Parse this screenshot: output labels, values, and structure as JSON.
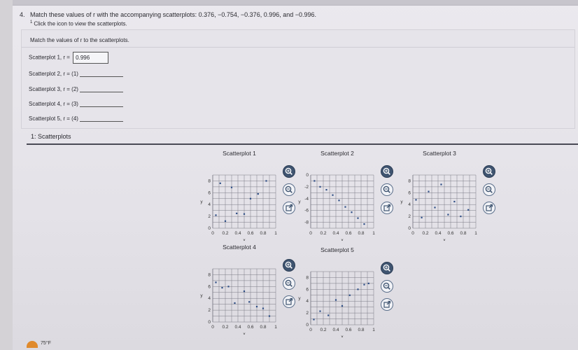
{
  "question": {
    "number": "4.",
    "text": "Match these values of r with the accompanying scatterplots: 0.376, −0.754, −0.376, 0.996, and −0.996.",
    "note_marker": "1",
    "note": "Click the icon to view the scatterplots."
  },
  "answers": {
    "instruction": "Match the values of r to the scatterplots.",
    "rows": [
      {
        "label": "Scatterplot 1, r =",
        "value": "0.996",
        "placeholder": ""
      },
      {
        "label": "Scatterplot 2, r =",
        "placeholder": "(1)"
      },
      {
        "label": "Scatterplot 3, r =",
        "placeholder": "(2)"
      },
      {
        "label": "Scatterplot 4, r =",
        "placeholder": "(3)"
      },
      {
        "label": "Scatterplot 5, r =",
        "placeholder": "(4)"
      }
    ]
  },
  "section": {
    "label": "1: Scatterplots"
  },
  "chart_data": [
    {
      "type": "scatter",
      "title": "Scatterplot 1",
      "xlabel": "x",
      "ylabel": "y",
      "xlim": [
        0,
        1
      ],
      "ylim": [
        0,
        9
      ],
      "xticks": [
        "0",
        "0.2",
        "0.4",
        "0.6",
        "0.8",
        "1"
      ],
      "yticks": [
        "0",
        "2",
        "4",
        "6",
        "8"
      ],
      "x": [
        0.05,
        0.12,
        0.2,
        0.3,
        0.38,
        0.5,
        0.6,
        0.72,
        0.85
      ],
      "y": [
        2.2,
        7.6,
        1.2,
        6.9,
        2.5,
        2.4,
        5.0,
        5.8,
        8.0
      ]
    },
    {
      "type": "scatter",
      "title": "Scatterplot 2",
      "xlabel": "x",
      "ylabel": "y",
      "xlim": [
        0,
        1
      ],
      "ylim": [
        -9,
        0
      ],
      "xticks": [
        "0",
        "0.2",
        "0.4",
        "0.6",
        "0.8",
        "1"
      ],
      "yticks": [
        "0",
        "-2",
        "-4",
        "-6",
        "-8"
      ],
      "x": [
        0.06,
        0.15,
        0.25,
        0.35,
        0.45,
        0.55,
        0.65,
        0.75,
        0.85
      ],
      "y": [
        -1.0,
        -2.0,
        -2.5,
        -3.4,
        -4.3,
        -5.4,
        -6.3,
        -7.3,
        -8.3
      ]
    },
    {
      "type": "scatter",
      "title": "Scatterplot 3",
      "xlabel": "x",
      "ylabel": "y",
      "xlim": [
        0,
        1
      ],
      "ylim": [
        0,
        9
      ],
      "xticks": [
        "0",
        "0.2",
        "0.4",
        "0.6",
        "0.8",
        "1"
      ],
      "yticks": [
        "0",
        "2",
        "4",
        "6",
        "8"
      ],
      "x": [
        0.05,
        0.14,
        0.25,
        0.35,
        0.45,
        0.56,
        0.66,
        0.76,
        0.88
      ],
      "y": [
        4.8,
        1.8,
        6.2,
        3.5,
        7.4,
        2.3,
        4.5,
        2.0,
        3.1
      ]
    },
    {
      "type": "scatter",
      "title": "Scatterplot 4",
      "xlabel": "x",
      "ylabel": "y",
      "xlim": [
        0,
        1
      ],
      "ylim": [
        0,
        9
      ],
      "xticks": [
        "0",
        "0.2",
        "0.4",
        "0.6",
        "0.8",
        "1"
      ],
      "yticks": [
        "0",
        "2",
        "4",
        "6",
        "8"
      ],
      "x": [
        0.05,
        0.15,
        0.25,
        0.35,
        0.5,
        0.58,
        0.7,
        0.8,
        0.9
      ],
      "y": [
        6.7,
        5.8,
        6.0,
        3.2,
        5.2,
        3.4,
        2.6,
        2.3,
        1.0
      ]
    },
    {
      "type": "scatter",
      "title": "Scatterplot 5",
      "xlabel": "x",
      "ylabel": "y",
      "xlim": [
        0,
        1
      ],
      "ylim": [
        0,
        9
      ],
      "xticks": [
        "0",
        "0.2",
        "0.4",
        "0.6",
        "0.8",
        "1"
      ],
      "yticks": [
        "0",
        "2",
        "4",
        "6",
        "8"
      ],
      "x": [
        0.05,
        0.15,
        0.28,
        0.4,
        0.5,
        0.62,
        0.75,
        0.85,
        0.92
      ],
      "y": [
        0.9,
        2.3,
        1.6,
        4.2,
        3.2,
        5.0,
        6.0,
        6.8,
        7.0
      ]
    }
  ],
  "icons": [
    "zoom-in-icon",
    "zoom-out-icon",
    "popout-icon"
  ],
  "taskbar": {
    "temperature": "75°F"
  },
  "colors": {
    "point": "#2f4f86",
    "grid": "#7a7a85",
    "icon": "#3f5470"
  }
}
